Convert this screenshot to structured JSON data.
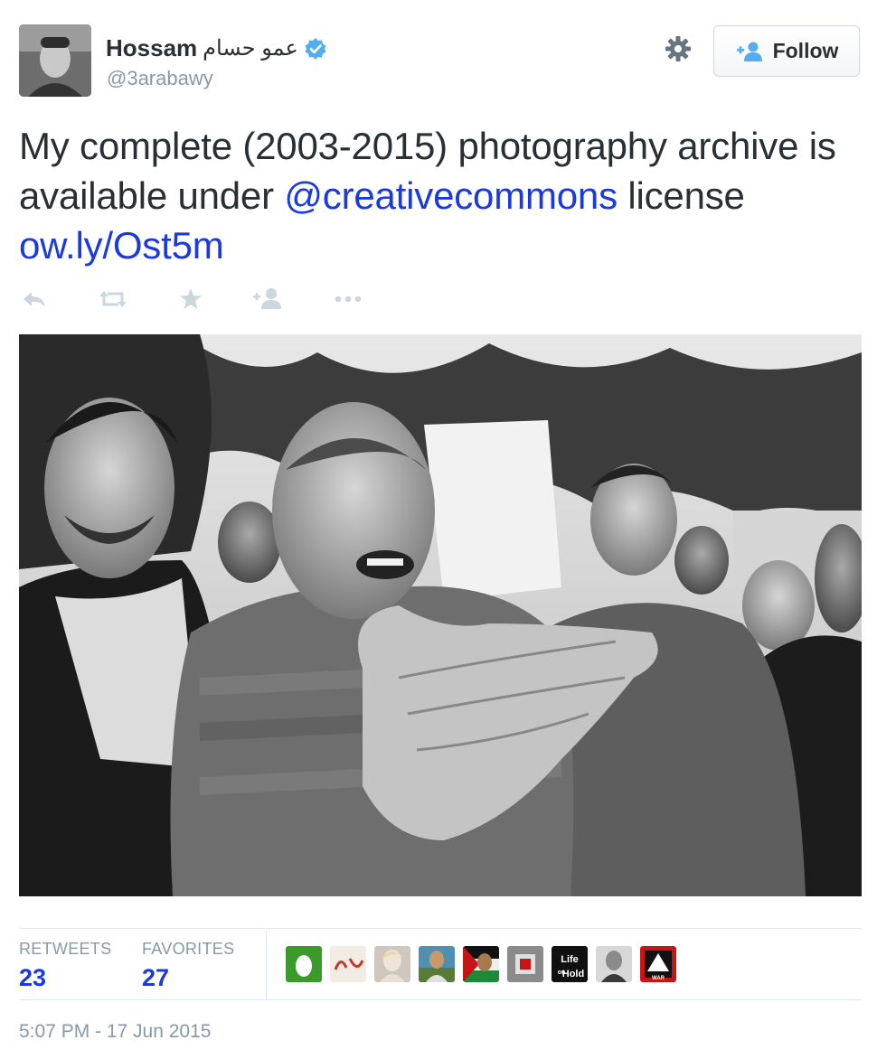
{
  "author": {
    "name": "Hossam",
    "name_arabic": "عمو حسام",
    "handle": "@3arabawy",
    "verified": true
  },
  "header": {
    "settings_icon": "gear-icon",
    "follow_label": "Follow"
  },
  "tweet": {
    "text_part1": "My complete (2003-2015) photography archive is available under ",
    "mention": "@creativecommons",
    "text_part2": " license ",
    "link": "ow.ly/Ost5m"
  },
  "actions": [
    {
      "name": "reply",
      "icon": "reply-icon"
    },
    {
      "name": "retweet",
      "icon": "retweet-icon"
    },
    {
      "name": "favorite",
      "icon": "star-icon"
    },
    {
      "name": "follow",
      "icon": "add-user-icon"
    },
    {
      "name": "more",
      "icon": "more-icon"
    }
  ],
  "stats": {
    "retweets_label": "RETWEETS",
    "retweets_count": "23",
    "favorites_label": "FAVORITES",
    "favorites_count": "27"
  },
  "favoriters": [
    {
      "name": "green-egg-avatar",
      "color": "#3a9a2a"
    },
    {
      "name": "arabic-text-avatar",
      "color": "#f2ece4"
    },
    {
      "name": "woman-avatar",
      "color": "#cfc6bd"
    },
    {
      "name": "man-outdoors-avatar",
      "color": "#4f8fb0"
    },
    {
      "name": "flag-avatar",
      "color": "#8a5a2a"
    },
    {
      "name": "red-frame-avatar",
      "color": "#8a8a8a"
    },
    {
      "name": "life-on-hold-avatar",
      "color": "#111111",
      "text": "Life on Hold"
    },
    {
      "name": "grayscale-man-avatar",
      "color": "#9a9a9a"
    },
    {
      "name": "war-business-avatar",
      "color": "#c51515",
      "text": "WAR IS BUSINESS"
    }
  ],
  "timestamp": "5:07 PM - 17 Jun 2015",
  "colors": {
    "link": "#1b39e0",
    "muted": "#8899a6",
    "verified": "#55acee"
  }
}
